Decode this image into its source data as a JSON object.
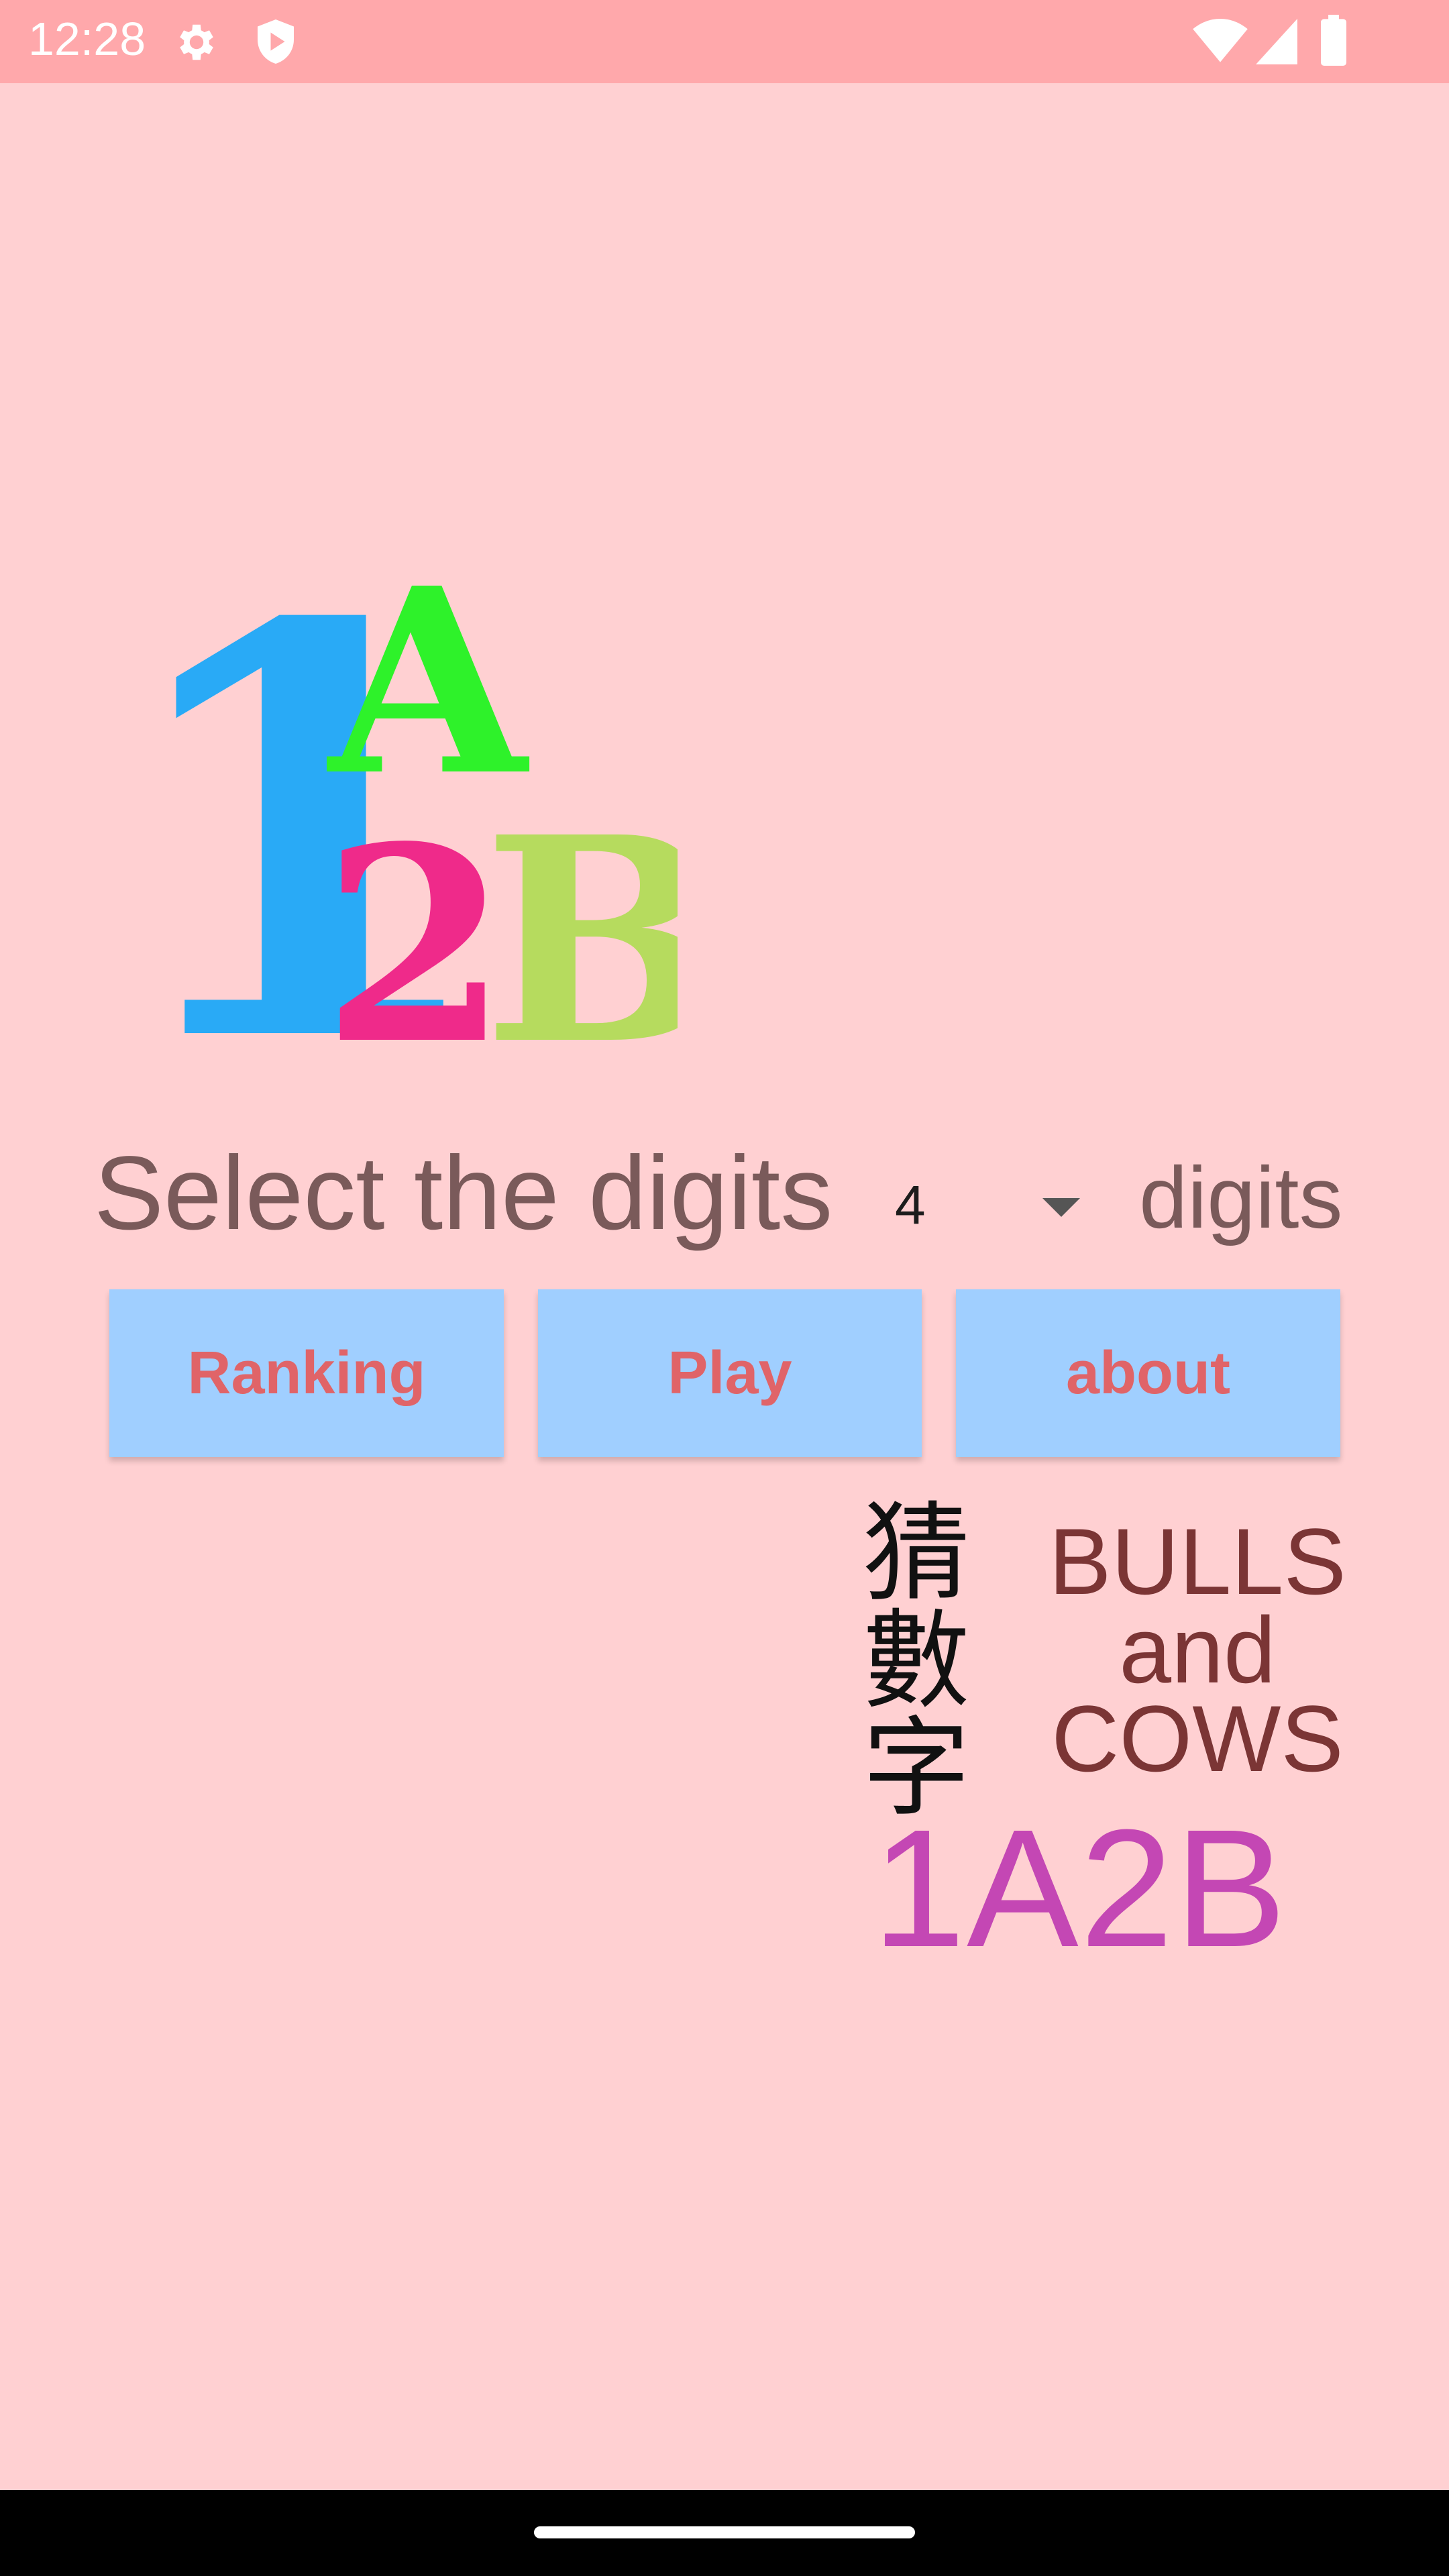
{
  "status_bar": {
    "time": "12:28",
    "icons": [
      "settings-icon",
      "shield-play-icon",
      "wifi-icon",
      "signal-icon",
      "battery-icon"
    ]
  },
  "logo": {
    "glyphs": [
      "1",
      "A",
      "2",
      "B"
    ],
    "colors": {
      "one": "#29aaf6",
      "a": "#2ef22a",
      "two": "#ef2a8a",
      "b": "#b6db5e"
    }
  },
  "digits_selector": {
    "label": "Select the digits",
    "value": "4",
    "suffix": "digits"
  },
  "buttons": {
    "ranking": "Ranking",
    "play": "Play",
    "about": "about"
  },
  "title_block": {
    "cjk": [
      "猜",
      "數",
      "字"
    ],
    "english": [
      "BULLS",
      "and",
      "COWS"
    ],
    "brand": "1A2B"
  },
  "colors": {
    "background": "#ffd0d2",
    "status_bar": "#ffa8ab",
    "button": "#a0cfff",
    "button_text": "#e06468",
    "brand": "#c447b4"
  }
}
